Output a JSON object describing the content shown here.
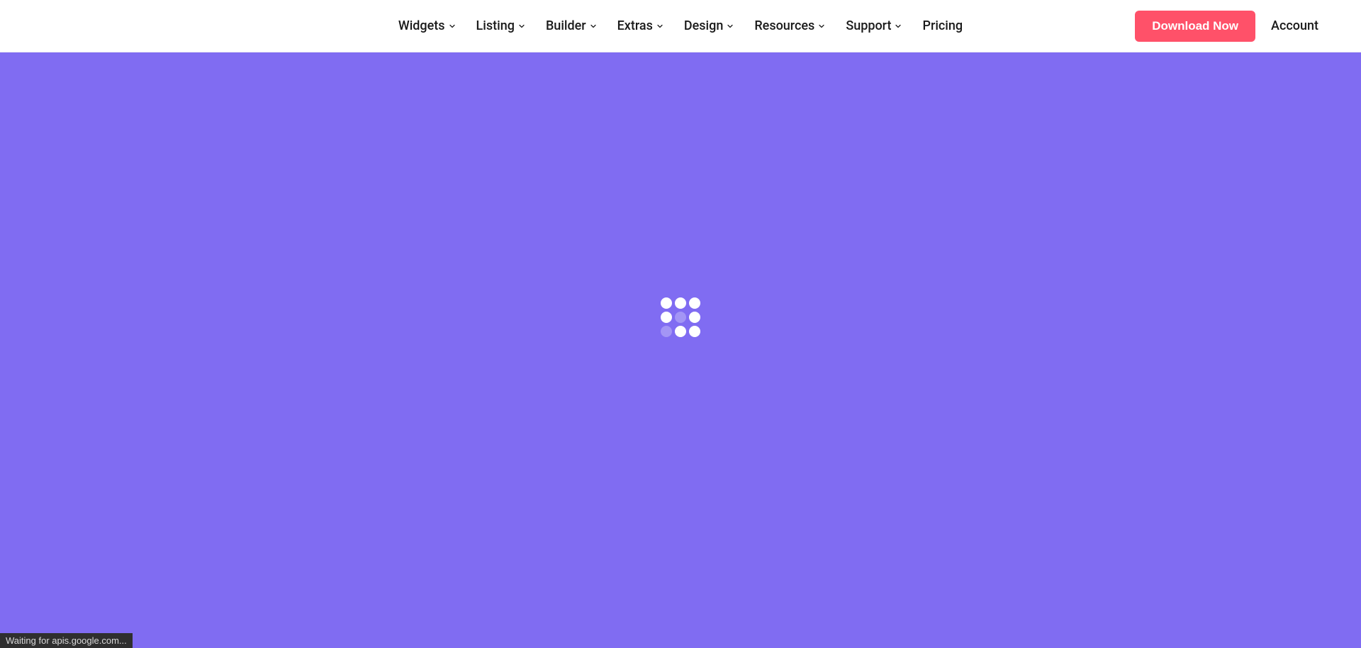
{
  "nav": {
    "items": [
      {
        "label": "Widgets",
        "hasDropdown": true
      },
      {
        "label": "Listing",
        "hasDropdown": true
      },
      {
        "label": "Builder",
        "hasDropdown": true
      },
      {
        "label": "Extras",
        "hasDropdown": true
      },
      {
        "label": "Design",
        "hasDropdown": true
      },
      {
        "label": "Resources",
        "hasDropdown": true
      },
      {
        "label": "Support",
        "hasDropdown": true
      },
      {
        "label": "Pricing",
        "hasDropdown": false
      }
    ]
  },
  "header": {
    "download_label": "Download Now",
    "account_label": "Account"
  },
  "colors": {
    "accent": "#ff5169",
    "hero_bg": "#806cf2"
  },
  "loader": {
    "dots": [
      {
        "faded": false
      },
      {
        "faded": false
      },
      {
        "faded": false
      },
      {
        "faded": false
      },
      {
        "faded": true
      },
      {
        "faded": false
      },
      {
        "faded": true
      },
      {
        "faded": false
      },
      {
        "faded": false
      }
    ]
  },
  "status": {
    "text": "Waiting for apis.google.com..."
  }
}
